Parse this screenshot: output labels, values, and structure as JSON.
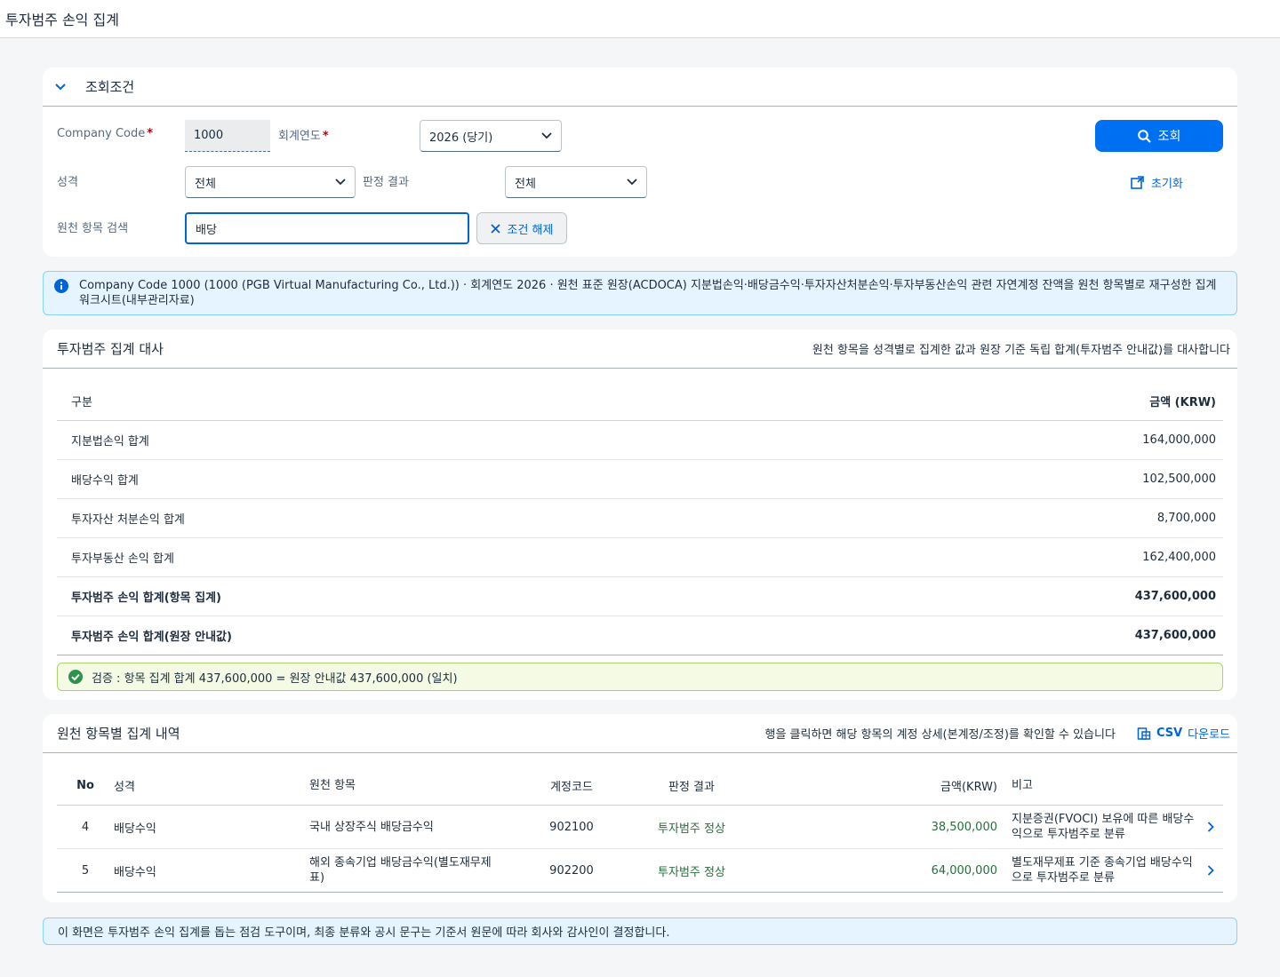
{
  "app": {
    "title": "투자범주 손익 집계"
  },
  "filter": {
    "title": "조회조건",
    "company_code_label": "Company Code",
    "company_code_value": "1000",
    "fiscal_year_label": "회계연도",
    "fiscal_year_value": "2026 (당기)",
    "nature_label": "성격",
    "nature_value": "전체",
    "judgement_label": "판정 결과",
    "judgement_value": "전체",
    "search_label": "원천 항목 검색",
    "search_value": "배당",
    "clear_label": "조건 해제",
    "query_label": "조회",
    "reset_label": "초기화"
  },
  "info": {
    "text": "Company Code 1000 (1000 (PGB Virtual Manufacturing Co., Ltd.)) · 회계연도 2026 · 원천 표준 원장(ACDOCA) 지분법손익·배당금수익·투자자산처분손익·투자부동산손익 관련 자연계정 잔액을 원천 항목별로 재구성한 집계 워크시트(내부관리자료)"
  },
  "summary": {
    "title": "투자범주 집계 대사",
    "hint": "원천 항목을 성격별로 집계한 값과 원장 기준 독립 합계(투자범주 안내값)를 대사합니다",
    "col_label": "구분",
    "col_amount": "금액 (KRW)",
    "rows": [
      {
        "label": "지분법손익 합계",
        "amount": "164,000,000"
      },
      {
        "label": "배당수익 합계",
        "amount": "102,500,000"
      },
      {
        "label": "투자자산 처분손익 합계",
        "amount": "8,700,000"
      },
      {
        "label": "투자부동산 손익 합계",
        "amount": "162,400,000"
      },
      {
        "label": "투자범주 손익 합계(항목 집계)",
        "amount": "437,600,000"
      },
      {
        "label": "투자범주 손익 합계(원장 안내값)",
        "amount": "437,600,000"
      }
    ],
    "check_text": "검증 : 항목 집계 합계 437,600,000 = 원장 안내값 437,600,000 (일치)"
  },
  "detail": {
    "title": "원천 항목별 집계 내역",
    "hint": "행을 클릭하면 해당 항목의 계정 상세(본계정/조정)를 확인할 수 있습니다",
    "csv_label_bold": "CSV",
    "csv_label": "다운로드",
    "columns": {
      "no": "No",
      "type": "성격",
      "item": "원천 항목",
      "code": "계정코드",
      "judge": "판정 결과",
      "amount": "금액(KRW)",
      "note": "비고"
    },
    "rows": [
      {
        "no": "4",
        "type": "배당수익",
        "item": "국내 상장주식 배당금수익",
        "code": "902100",
        "judge": "투자범주 정상",
        "amount": "38,500,000",
        "note": "지분증권(FVOCI) 보유에 따른 배당수익으로 투자범주로 분류"
      },
      {
        "no": "5",
        "type": "배당수익",
        "item": "해외 종속기업 배당금수익(별도재무제표)",
        "code": "902200",
        "judge": "투자범주 정상",
        "amount": "64,000,000",
        "note": "별도재무제표 기준 종속기업 배당수익으로 투자범주로 분류"
      }
    ]
  },
  "notice": {
    "text": "이 화면은 투자범주 손익 집계를 돕는 점검 도구이며, 최종 분류와 공시 문구는 기준서 원문에 따라 회사와 감사인이 결정합니다."
  }
}
